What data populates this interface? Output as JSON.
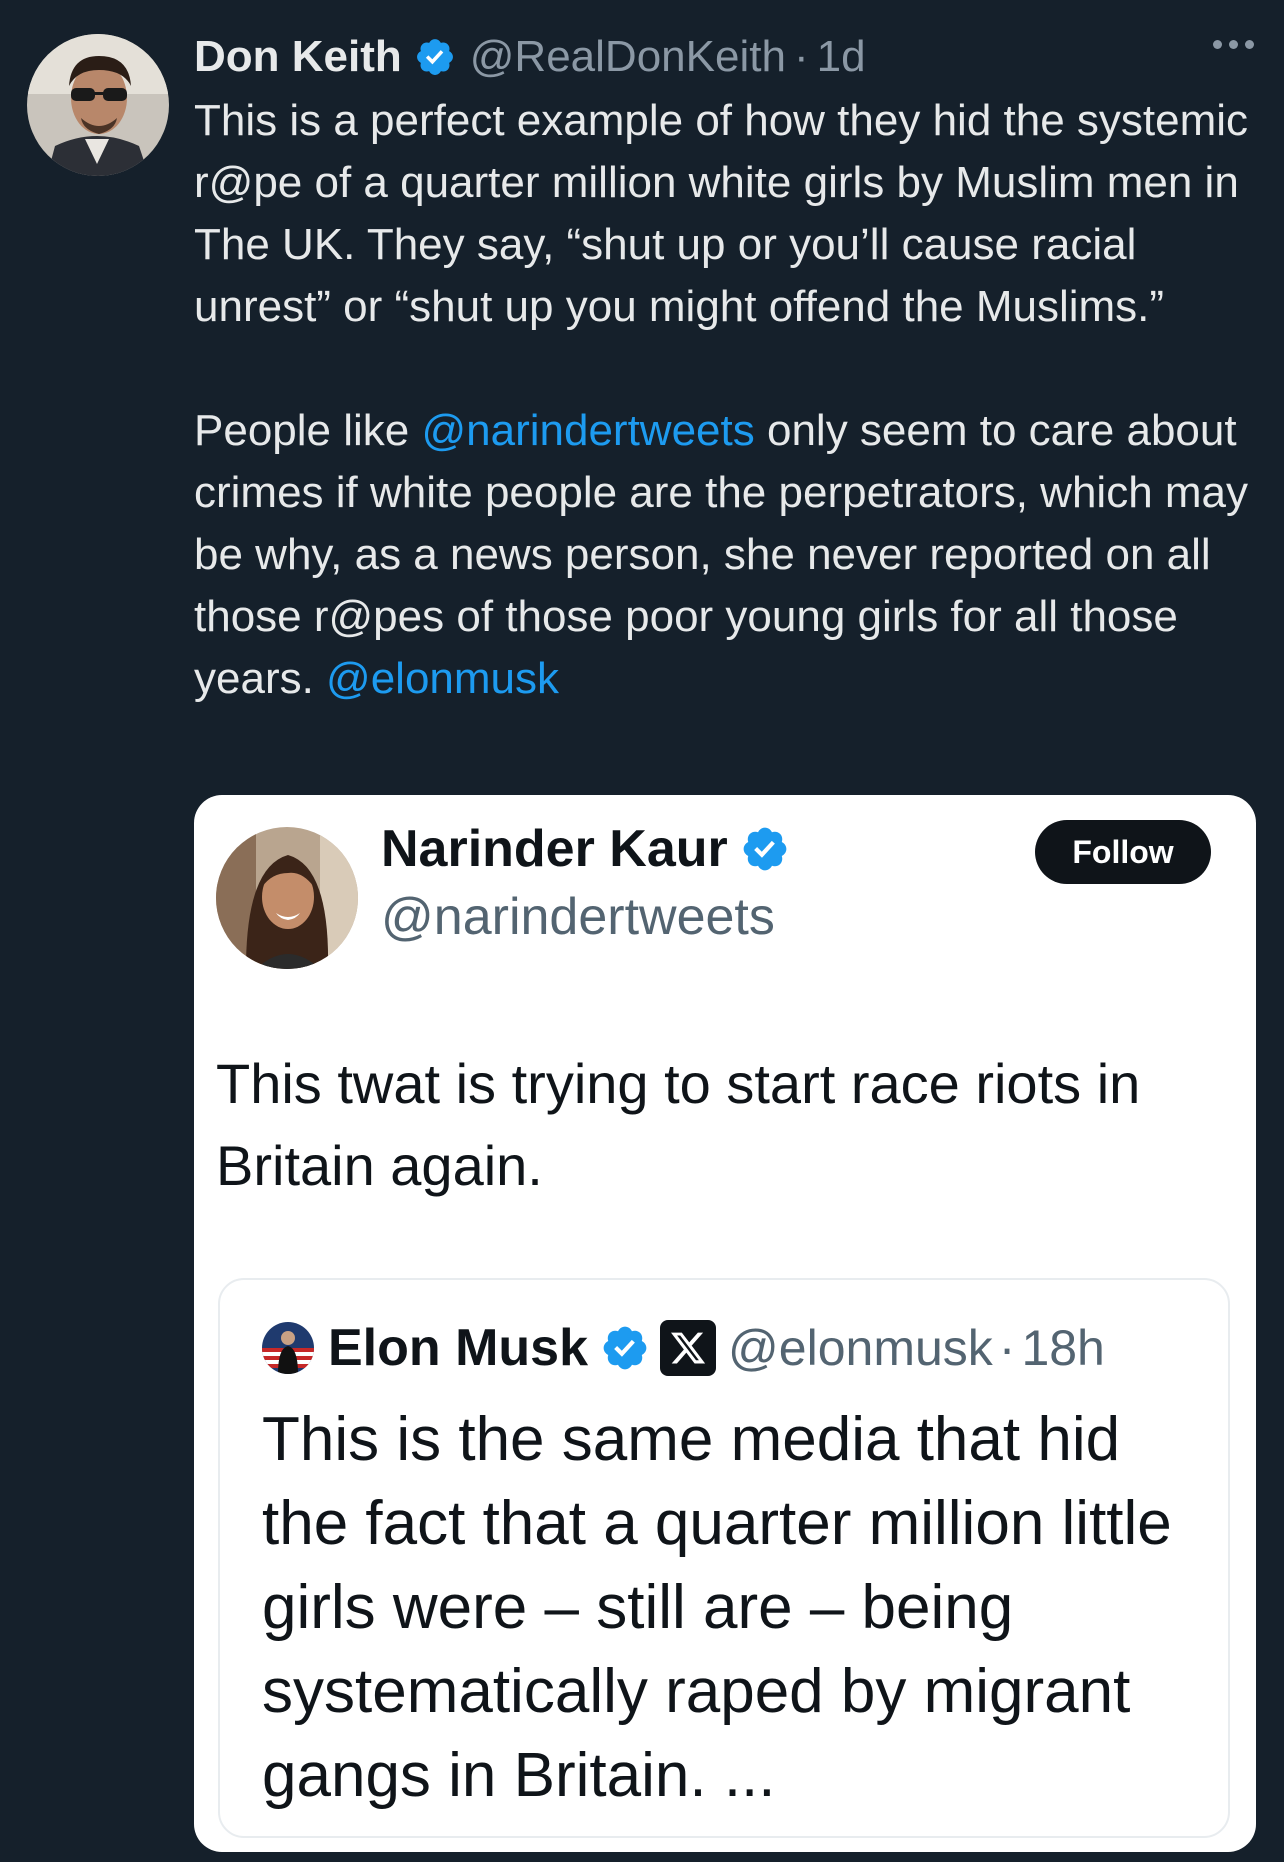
{
  "tweet": {
    "author_name": "Don Keith",
    "author_handle": "@RealDonKeith",
    "separator": "·",
    "time": "1d",
    "avatar_icon": "profile-photo-man-sunglasses",
    "more_icon": "more-dots-icon",
    "paragraph1": "This is a perfect example of how they hid the systemic r@pe of a quarter million white girls by Muslim men in The UK. They say, “shut up or you’ll cause racial unrest” or “shut up you might offend the Muslims.”",
    "paragraph2_prefix": "People like ",
    "paragraph2_mention": "@narindertweets",
    "paragraph2_middle": " only seem to care about crimes if white people are the perpetrators, which may be why, as a news person, she never reported on all those r@pes of those poor young girls for all those years. ",
    "paragraph2_mention2": "@elonmusk"
  },
  "embedded": {
    "author_name": "Narinder Kaur",
    "author_handle": "@narindertweets",
    "follow_label": "Follow",
    "text": "This twat is trying to start race riots in Britain again.",
    "quote": {
      "author_name": "Elon Musk",
      "author_handle": "@elonmusk",
      "separator": "·",
      "time": "18h",
      "text": "This is the same media that hid the fact that a quarter million little girls were – still are – being systematically raped by migrant gangs in Britain. ..."
    }
  },
  "colors": {
    "background": "#15202b",
    "text_primary_dark": "#e7e9ea",
    "text_secondary_dark": "#8b98a5",
    "link": "#1d9bf0",
    "verified": "#1d9bf0",
    "card_background": "#ffffff",
    "card_text": "#0f1419",
    "card_secondary": "#536471"
  }
}
